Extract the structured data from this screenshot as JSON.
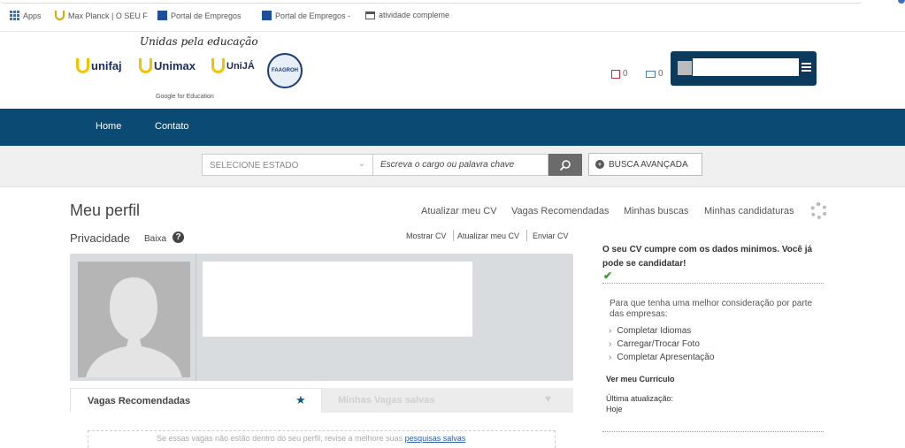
{
  "bookmarks": {
    "apps": "Apps",
    "items": [
      {
        "label": "Max Planck | O SEU F",
        "icon": "maxplanck-icon"
      },
      {
        "label": "Portal de Empregos",
        "icon": "portal-icon"
      },
      {
        "label": "Portal de Empregos -",
        "icon": "portal-icon"
      },
      {
        "label": "atividade compleme",
        "icon": "page-icon"
      }
    ]
  },
  "header": {
    "tagline": "Unidas pela educação",
    "logos": [
      "unifaj",
      "Unimax",
      "UniJÁ"
    ],
    "seal_text": "FAAGROH",
    "google_edu": "Google for Education",
    "messages_count": "0",
    "notifications_count": "0"
  },
  "nav": {
    "items": [
      "Home",
      "Contato"
    ]
  },
  "search": {
    "state_placeholder": "SELECIONE ESTADO",
    "keyword_placeholder": "Escreva o cargo ou palavra chave",
    "advanced_label": "BUSCA AVANÇADA"
  },
  "profile": {
    "title": "Meu perfil",
    "top_links": [
      "Atualizar meu CV",
      "Vagas Recomendadas",
      "Minhas buscas",
      "Minhas candidaturas"
    ],
    "privacy_label": "Privacidade",
    "privacy_value": "Baixa",
    "cv_actions": [
      "Mostrar CV",
      "Atualizar meu CV",
      "Enviar CV"
    ]
  },
  "tabs": {
    "recommended": "Vagas Recomendadas",
    "saved": "Minhas Vagas salvas",
    "content_text": "Se essas vagas não estão dentro do seu perfil, revise a melhore suas ",
    "content_link": "pesquisas salvas"
  },
  "sidebar": {
    "status_title": "O seu CV cumpre com os dados minimos. Você já pode se candidatar!",
    "intro": "Para que tenha uma melhor consideração por parte das empresas:",
    "items": [
      "Completar Idiomas",
      "Carregar/Trocar Foto",
      "Completar Apresentação"
    ],
    "view_cv": "Ver meu Currículo",
    "last_update_label": "Última atualização:",
    "last_update_value": "Hoje"
  },
  "colors": {
    "navbar": "#0b4a73",
    "user_box": "#0b3a5c",
    "check": "#3a9b2a"
  }
}
